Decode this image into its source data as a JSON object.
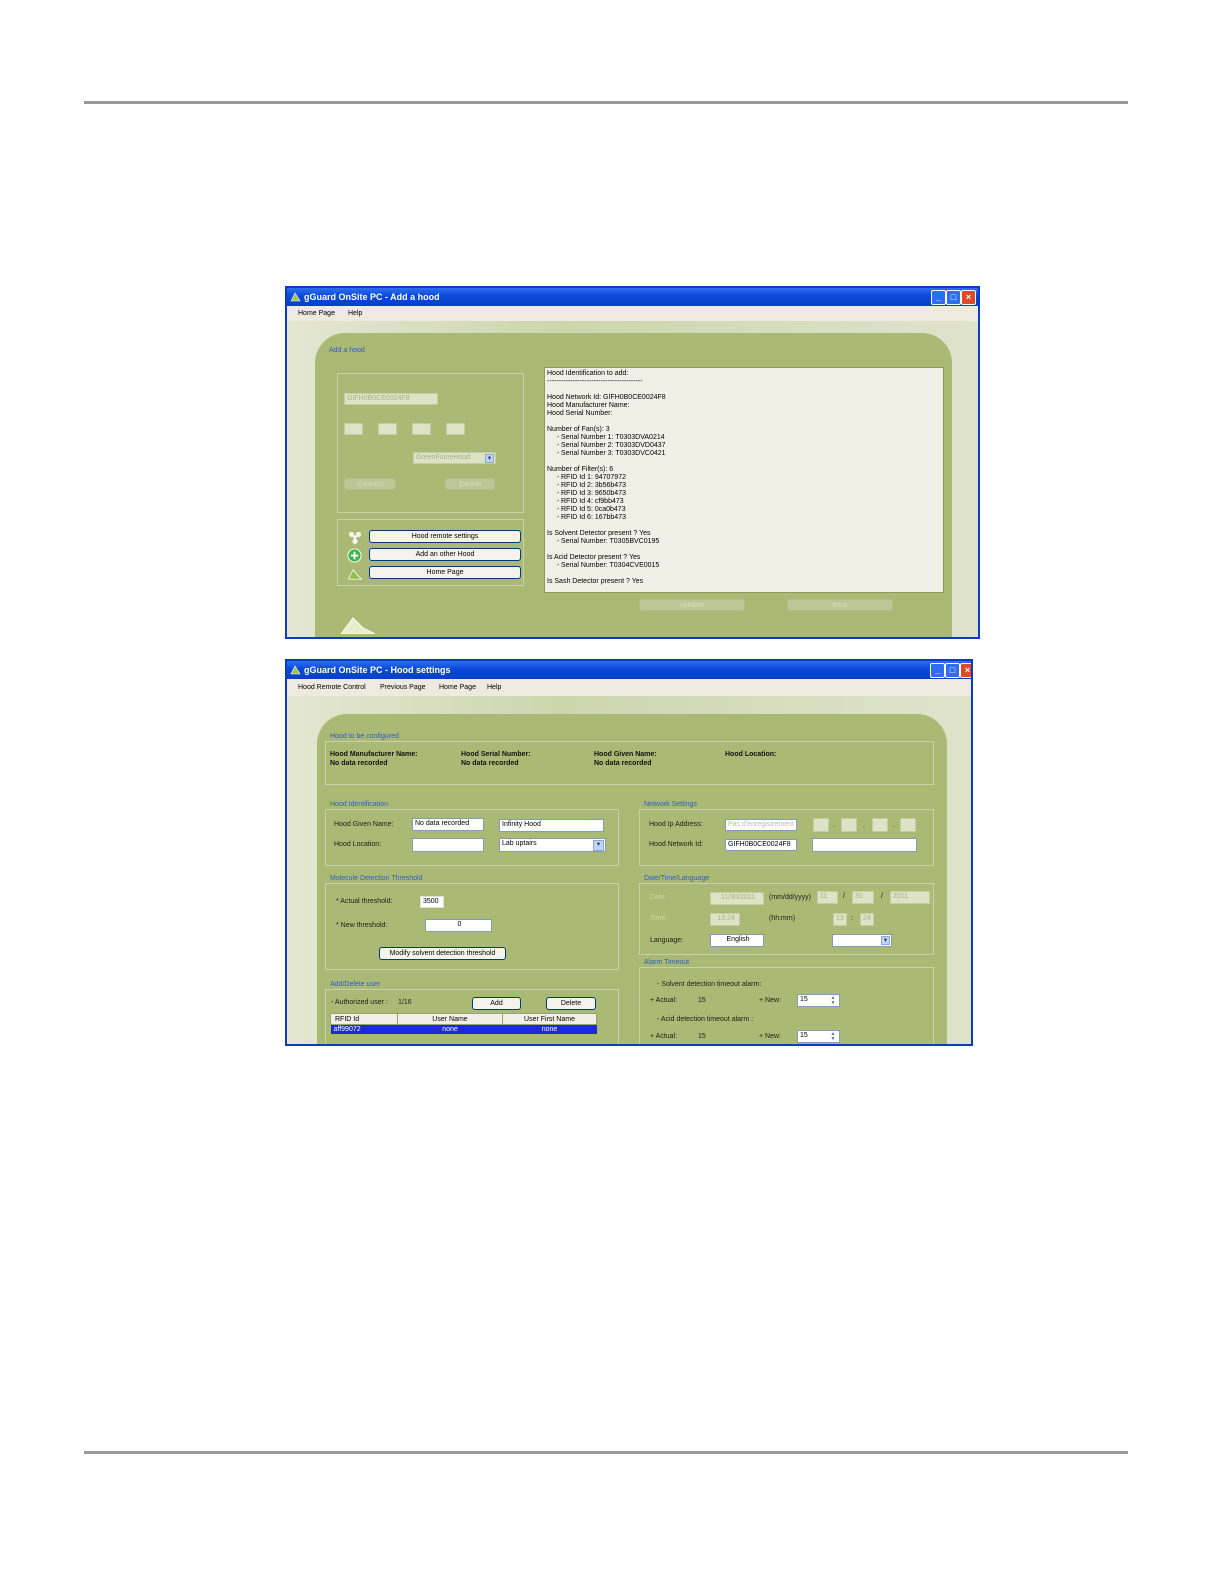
{
  "window1": {
    "title": "gGuard OnSite PC - Add a hood",
    "menu": [
      "Home Page",
      "Help"
    ],
    "section_title": "Add a hood",
    "disabled_network_id": "GIFH0B0CE0024F8",
    "disabled_select": "GreenFumeHood",
    "connect_label": "Connect",
    "cancel_label": "Cancel",
    "buttons": {
      "remote_settings": "Hood remote settings",
      "add_other": "Add an other Hood",
      "home": "Home Page"
    },
    "info_lines": [
      "Hood Identification to add:",
      "-----------------------------------------",
      "",
      "Hood Network Id: GIFH0B0CE0024F8",
      "Hood Manufacturer Name:",
      "Hood Serial Number:",
      "",
      "Number of Fan(s): 3",
      "     - Serial Number 1: T0303DVA0214",
      "     - Serial Number 2: T0303DVD0437",
      "     - Serial Number 3: T0303DVC0421",
      "",
      "Number of Filter(s): 6",
      "     - RFID Id 1: 94707972",
      "     - RFID Id 2: 3b56b473",
      "     - RFID Id 3: 9650b473",
      "     - RFID Id 4: cf9bb473",
      "     - RFID Id 5: 0ca0b473",
      "     - RFID Id 6: 167bb473",
      "",
      "Is Solvent Detector present ? Yes",
      "     - Serial Number: T0305BVC0195",
      "",
      "Is Acid Detector present ? Yes",
      "     - Serial Number: T0304CVE0015",
      "",
      "Is Sash Detector present ? Yes"
    ],
    "validate_label": "Validate",
    "back_label": "Back"
  },
  "window2": {
    "title": "gGuard OnSite PC - Hood settings",
    "menu": [
      "Hood Remote Control",
      "Previous Page",
      "Home Page",
      "Help"
    ],
    "configured": {
      "section_title": "Hood to be configured",
      "cols": [
        {
          "label": "Hood Manufacturer Name:",
          "value": "No data recorded"
        },
        {
          "label": "Hood Serial Number:",
          "value": "No data recorded"
        },
        {
          "label": "Hood Given Name:",
          "value": "No data recorded"
        },
        {
          "label": "Hood Location:",
          "value": ""
        }
      ]
    },
    "identification": {
      "section_title": "Hood Identification",
      "given_name_label": "Hood Given Name:",
      "given_name_current": "No data recorded",
      "given_name_new": "Infinity Hood",
      "location_label": "Hood Location:",
      "location_current": "",
      "location_new": "Lab uptairs"
    },
    "network": {
      "section_title": "Network Settings",
      "ip_label": "Hood Ip Address:",
      "ip_placeholder": "Pas d'enregistrement",
      "net_id_label": "Hood Network Id:",
      "net_id_value": "GIFH0B0CE0024F8"
    },
    "molecule": {
      "section_title": "Molecule Detection Threshold",
      "actual_label": "* Actual threshold:",
      "actual_value": "3500",
      "new_label": "* New threshold:",
      "new_value": "0",
      "modify_label": "Modify solvent detection threshold"
    },
    "datetime": {
      "section_title": "Date/Time/Language",
      "date_value": "11/30/2011",
      "date_format": "(mm/dd/yyyy)",
      "month": "11",
      "day": "30",
      "year": "2011",
      "time_value": "13:24",
      "time_format": "(hh:mm)",
      "hour": "13",
      "minute": "24",
      "language_label": "Language:",
      "language_value": "English"
    },
    "users": {
      "section_title": "Add/Delete user",
      "authorized_label": "- Authorized user :",
      "authorized_count": "1/16",
      "add_label": "Add",
      "delete_label": "Delete",
      "columns": [
        "RFID Id",
        "User Name",
        "User First Name"
      ],
      "rows": [
        [
          "aff99072",
          "none",
          "none"
        ]
      ]
    },
    "alarm": {
      "section_title": "Alarm Timeout",
      "solvent_label": "- Solvent detection timeout alarm:",
      "actual_label": "+ Actual:",
      "solvent_actual": "15",
      "new_label": "+ New:",
      "solvent_new": "15",
      "acid_label": "- Acid detection timeout alarm :",
      "acid_actual": "15",
      "acid_new": "15"
    }
  }
}
